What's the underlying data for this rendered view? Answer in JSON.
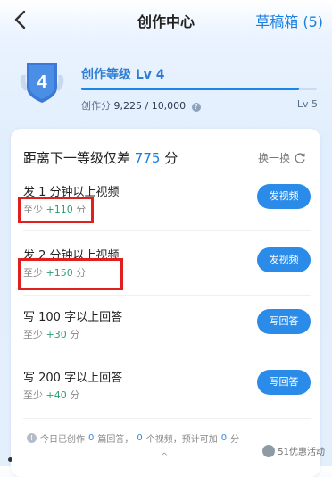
{
  "header": {
    "title": "创作中心",
    "drafts_label": "草稿箱 (5)"
  },
  "level": {
    "badge_number": "4",
    "title": "创作等级  Lv 4",
    "score_label": "创作分",
    "score_value": "9,225 / 10,000",
    "progress_fraction": 0.9225,
    "next_level": "Lv 5"
  },
  "card": {
    "title_prefix": "距离下一等级仅差",
    "title_value": "775",
    "title_suffix": "分",
    "refresh_label": "换一换",
    "tasks": [
      {
        "name": "发 1 分钟以上视频",
        "reward_prefix": "至少",
        "reward_points": "+110",
        "reward_suffix": "分",
        "button": "发视频"
      },
      {
        "name": "发 2 分钟以上视频",
        "reward_prefix": "至少",
        "reward_points": "+150",
        "reward_suffix": "分",
        "button": "发视频"
      },
      {
        "name": "写 100 字以上回答",
        "reward_prefix": "至少",
        "reward_points": "+30",
        "reward_suffix": "分",
        "button": "写回答"
      },
      {
        "name": "写 200 字以上回答",
        "reward_prefix": "至少",
        "reward_points": "+40",
        "reward_suffix": "分",
        "button": "写回答"
      }
    ]
  },
  "footer": {
    "text1": "今日已创作",
    "answers_count": "0",
    "text2": "篇回答，",
    "videos_count": "0",
    "text3": "个视频，预计可加",
    "points": "0",
    "text4": "分"
  },
  "watermark": "51优惠活动",
  "colors": {
    "accent": "#1a7ee0",
    "button": "#2a8be8",
    "points": "#2aa070",
    "highlight_box": "#e01f1f"
  }
}
